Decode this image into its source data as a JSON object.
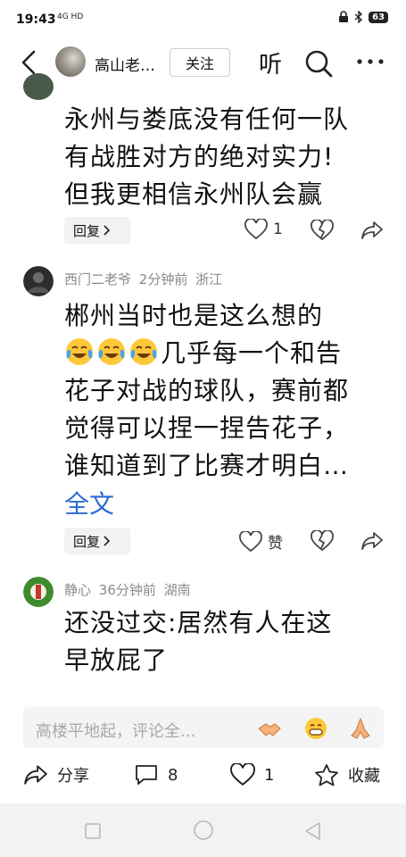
{
  "status_bar": {
    "time": "19:43",
    "signal": "4G HD",
    "battery": "63"
  },
  "header": {
    "author_name": "高山老…",
    "follow_label": "关注",
    "listen_label": "听"
  },
  "comments": [
    {
      "text_lines": [
        "永州与娄底没有任何一队",
        "有战胜对方的绝对实力!",
        "但我更相信永州队会赢"
      ],
      "reply_label": "回复",
      "like_count": "1"
    },
    {
      "user": "西门二老爷",
      "time": "2分钟前",
      "location": "浙江",
      "line1": "郴州当时也是这么想的",
      "line2_suffix": "几乎每一个和告",
      "line3": "花子对战的球队，赛前都",
      "line4": "觉得可以捏一捏告花子，",
      "line5": "谁知道到了比赛才明白…",
      "full_text_label": "全文",
      "reply_label": "回复",
      "like_label": "赞"
    },
    {
      "user": "静心",
      "time": "36分钟前",
      "location": "湖南",
      "text_lines": [
        "还没过交:居然有人在这",
        "早放屁了"
      ]
    }
  ],
  "input": {
    "placeholder": "高楼平地起，评论全..."
  },
  "bottom_bar": {
    "share_label": "分享",
    "comment_count": "8",
    "like_count": "1",
    "collect_label": "收藏"
  },
  "colors": {
    "link": "#2a6ad2",
    "meta": "#8a8a8a",
    "accent_heart": "#e7393b"
  },
  "icons": [
    "back-arrow-icon",
    "search-icon",
    "more-icon",
    "heart-icon",
    "broken-heart-icon",
    "share-icon",
    "comment-icon",
    "star-icon",
    "laughing-crying-emoji",
    "handshake-emoji",
    "grin-emoji",
    "pray-emoji"
  ]
}
